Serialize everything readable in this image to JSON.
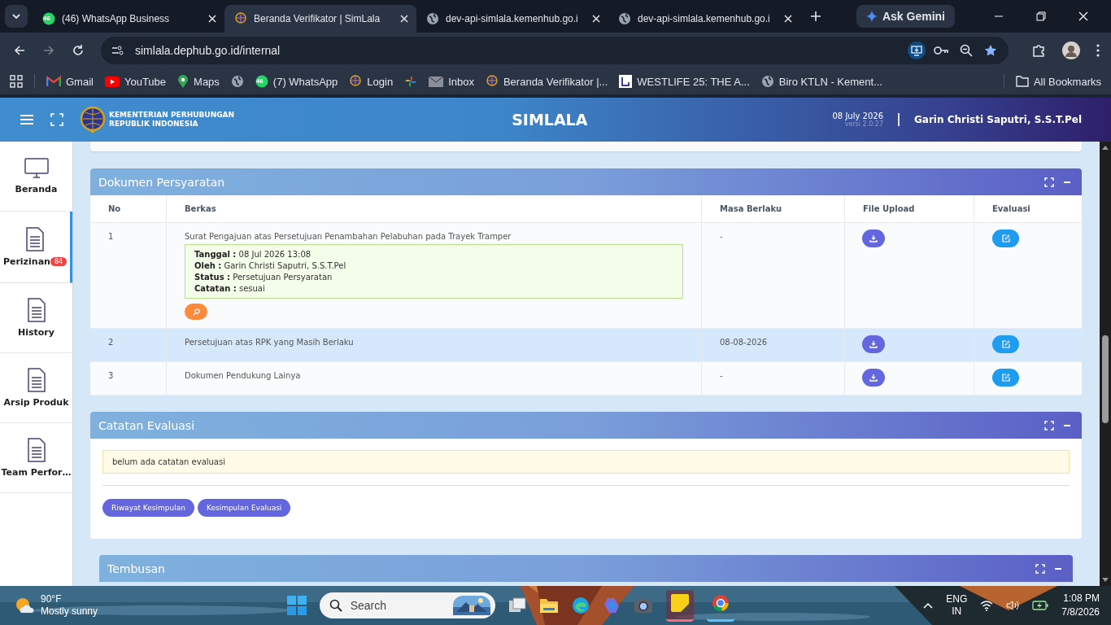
{
  "browser": {
    "tabs": [
      {
        "title": "(46) WhatsApp Business",
        "icon_badge": "46",
        "selected": false
      },
      {
        "title": "Beranda Verifikator | SimLala",
        "selected": true
      },
      {
        "title": "dev-api-simlala.kemenhub.go.i",
        "selected": false
      },
      {
        "title": "dev-api-simlala.kemenhub.go.i",
        "selected": false
      }
    ],
    "gemini": "Ask Gemini",
    "address": "simlala.dephub.go.id/internal",
    "bookmarks": [
      {
        "kind": "link",
        "label": "Gmail"
      },
      {
        "kind": "link",
        "label": "YouTube"
      },
      {
        "kind": "link",
        "label": "Maps"
      },
      {
        "kind": "icon"
      },
      {
        "kind": "link",
        "label": "(7) WhatsApp",
        "icon_badge": "46"
      },
      {
        "kind": "link",
        "label": "Login"
      },
      {
        "kind": "icon"
      },
      {
        "kind": "link",
        "label": "Inbox"
      },
      {
        "kind": "link",
        "label": "Beranda Verifikator |..."
      },
      {
        "kind": "link",
        "label": "WESTLIFE 25: THE A..."
      },
      {
        "kind": "link",
        "label": "Biro KTLN - Kement..."
      }
    ],
    "all_bookmarks": "All Bookmarks"
  },
  "header": {
    "org_line_1": "KEMENTERIAN PERHUBUNGAN",
    "org_line_2": "REPUBLIK INDONESIA",
    "app_title": "SIMLALA",
    "date": "08 July 2026",
    "version": "versi 2.0.27",
    "user": "Garin Christi Saputri, S.S.T.Pel"
  },
  "sidebar": {
    "items": [
      {
        "label": "Beranda",
        "selected": false
      },
      {
        "label": "Perizinan",
        "badge": "84",
        "selected": true
      },
      {
        "label": "History",
        "selected": false
      },
      {
        "label": "Arsip Produk",
        "selected": false
      },
      {
        "label": "Team Perfor…",
        "selected": false
      }
    ]
  },
  "documents": {
    "title": "Dokumen Persyaratan",
    "columns": [
      "No",
      "Berkas",
      "Masa Berlaku",
      "File Upload",
      "Evaluasi"
    ],
    "rows": [
      {
        "no": "1",
        "file": "Surat Pengajuan atas Persetujuan Penambahan Pelabuhan pada Trayek Tramper",
        "valid_until": "-",
        "highlighted": false,
        "review": [
          {
            "label": "Tanggal :",
            "value": "08 Jul 2026 13:08"
          },
          {
            "label": "Oleh :",
            "value": "Garin Christi Saputri, S.S.T.Pel"
          },
          {
            "label": "Status :",
            "value": "Persetujuan Persyaratan"
          },
          {
            "label": "Catatan :",
            "value": "sesuai"
          }
        ]
      },
      {
        "no": "2",
        "file": "Persetujuan atas RPK yang Masih Berlaku",
        "valid_until": "08-08-2026",
        "highlighted": true
      },
      {
        "no": "3",
        "file": "Dokumen Pendukung Lainya",
        "valid_until": "-",
        "highlighted": false
      }
    ]
  },
  "evaluation": {
    "title": "Catatan Evaluasi",
    "note": "belum ada catatan evaluasi",
    "buttons": [
      "Riwayat Kesimpulan",
      "Kesimpulan Evaluasi"
    ]
  },
  "cc": {
    "title": "Tembusan"
  },
  "taskbar": {
    "temperature": "90°F",
    "weather": "Mostly sunny",
    "search_placeholder": "Search",
    "language": "ENG",
    "region": "IN",
    "time": "1:08 PM",
    "date": "7/8/2026"
  }
}
